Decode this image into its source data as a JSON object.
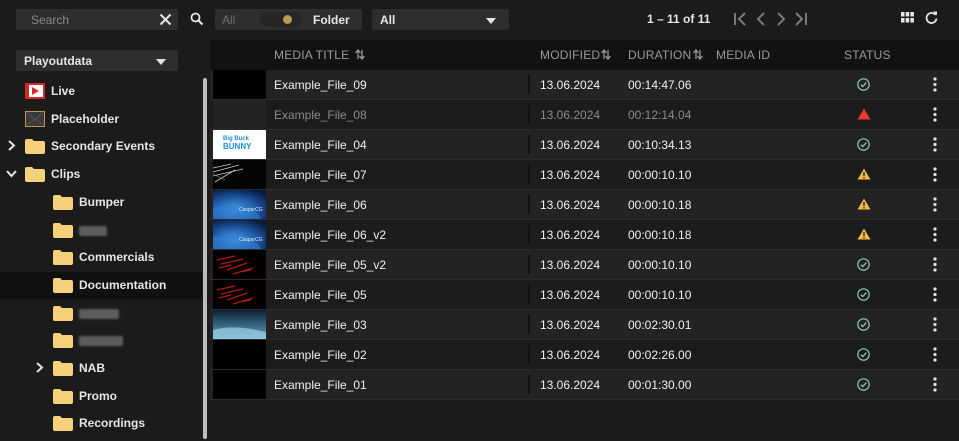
{
  "search": {
    "placeholder": "Search"
  },
  "filter_toggle": {
    "left_label": "All",
    "right_label": "Folder"
  },
  "filter_select": {
    "value": "All"
  },
  "pager": {
    "label": "1 – 11 of 11"
  },
  "source": {
    "value": "Playoutdata"
  },
  "tree": [
    {
      "label": "Live",
      "icon": "live-icon"
    },
    {
      "label": "Placeholder",
      "icon": "placeholder-icon"
    },
    {
      "label": "Secondary Events",
      "icon": "folder-icon",
      "expandable": true
    },
    {
      "label": "Clips",
      "icon": "folder-icon",
      "expanded": true
    },
    {
      "label": "Bumper",
      "icon": "folder-icon"
    },
    {
      "label": "",
      "icon": "folder-icon",
      "redacted": true
    },
    {
      "label": "Commercials",
      "icon": "folder-icon"
    },
    {
      "label": "Documentation",
      "icon": "folder-icon",
      "selected": true
    },
    {
      "label": "",
      "icon": "folder-icon",
      "redacted": true
    },
    {
      "label": "",
      "icon": "folder-icon",
      "redacted": true
    },
    {
      "label": "NAB",
      "icon": "folder-icon",
      "expandable": true
    },
    {
      "label": "Promo",
      "icon": "folder-icon"
    },
    {
      "label": "Recordings",
      "icon": "folder-icon"
    }
  ],
  "columns": {
    "title": "MEDIA TITLE",
    "modified": "MODIFIED",
    "duration": "DURATION",
    "media_id": "MEDIA ID",
    "status": "STATUS"
  },
  "rows": [
    {
      "title": "Example_File_09",
      "modified": "13.06.2024",
      "duration": "00:14:47.06",
      "status": "ok",
      "thumb": "black",
      "dim": false
    },
    {
      "title": "Example_File_08",
      "modified": "13.06.2024",
      "duration": "00:12:14.04",
      "status": "error",
      "thumb": "none",
      "dim": true
    },
    {
      "title": "Example_File_04",
      "modified": "13.06.2024",
      "duration": "00:10:34.13",
      "status": "ok",
      "thumb": "bunny",
      "dim": false
    },
    {
      "title": "Example_File_07",
      "modified": "13.06.2024",
      "duration": "00:00:10.10",
      "status": "warning",
      "thumb": "streak",
      "dim": false
    },
    {
      "title": "Example_File_06",
      "modified": "13.06.2024",
      "duration": "00:00:10.18",
      "status": "warning",
      "thumb": "earth",
      "dim": false
    },
    {
      "title": "Example_File_06_v2",
      "modified": "13.06.2024",
      "duration": "00:00:10.18",
      "status": "warning",
      "thumb": "earth",
      "dim": false
    },
    {
      "title": "Example_File_05_v2",
      "modified": "13.06.2024",
      "duration": "00:00:10.10",
      "status": "ok",
      "thumb": "red",
      "dim": false
    },
    {
      "title": "Example_File_05",
      "modified": "13.06.2024",
      "duration": "00:00:10.10",
      "status": "ok",
      "thumb": "red",
      "dim": false
    },
    {
      "title": "Example_File_03",
      "modified": "13.06.2024",
      "duration": "00:02:30.01",
      "status": "ok",
      "thumb": "sky",
      "dim": false
    },
    {
      "title": "Example_File_02",
      "modified": "13.06.2024",
      "duration": "00:02:26.00",
      "status": "ok",
      "thumb": "black",
      "dim": false
    },
    {
      "title": "Example_File_01",
      "modified": "13.06.2024",
      "duration": "00:01:30.00",
      "status": "ok",
      "thumb": "black",
      "dim": false
    }
  ],
  "thumb_text": {
    "bunny_line1": "Big Buck",
    "bunny_line2": "BUNNY",
    "earth": "CasparCG"
  },
  "colors": {
    "ok": "#8fc7a8",
    "error": "#e23a2a",
    "warning": "#f0b845",
    "folder": "#f5d27a",
    "accent": "#b99a52"
  }
}
